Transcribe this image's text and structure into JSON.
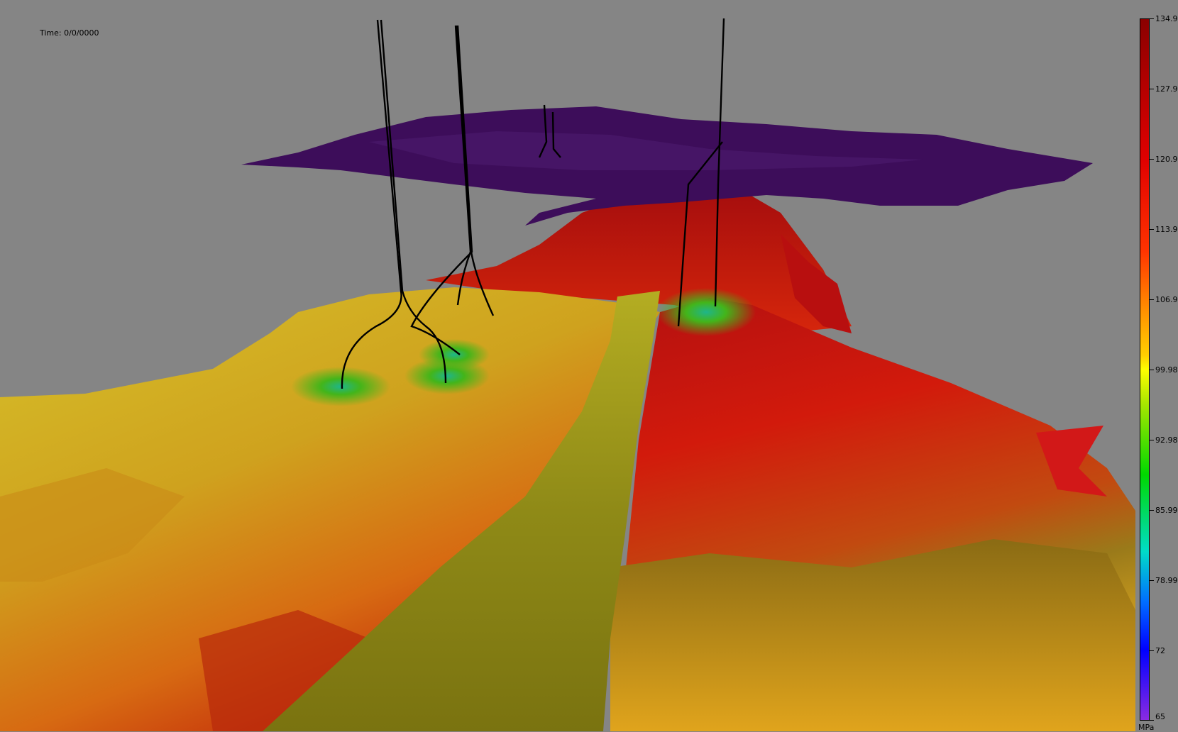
{
  "viewer": {
    "time_label": "Time: 0/0/0000",
    "legend": {
      "unit": "MPa",
      "ticks": [
        "134.9",
        "127.9",
        "120.9",
        "113.9",
        "106.9",
        "99.98",
        "92.98",
        "85.99",
        "78.99",
        "72",
        "65"
      ],
      "min": 65,
      "max": 134.9,
      "colors": [
        "#8b0000",
        "#e00000",
        "#ff3300",
        "#ff8a00",
        "#ffd000",
        "#ffff00",
        "#a6e600",
        "#00d800",
        "#00dcc8",
        "#0070ff",
        "#0000ff",
        "#8a2be2"
      ]
    }
  }
}
